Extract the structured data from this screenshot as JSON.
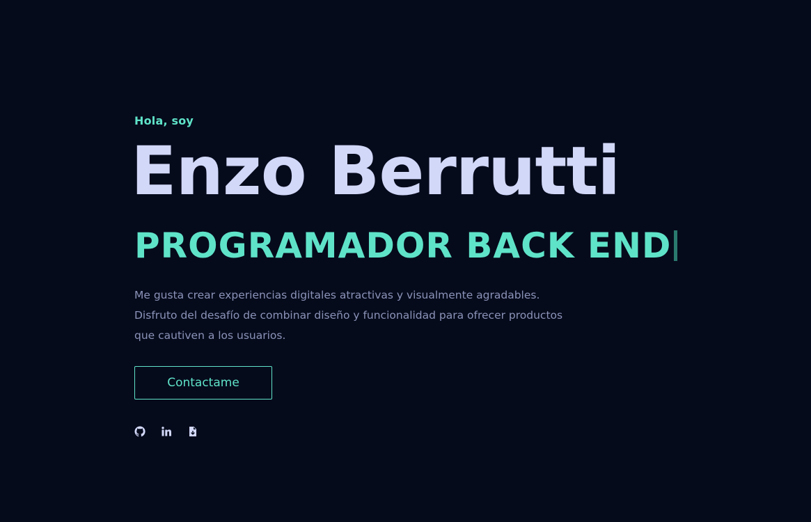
{
  "hero": {
    "greeting": "Hola, soy",
    "name": "Enzo Berrutti",
    "role": "PROGRAMADOR BACK END",
    "description_lines": [
      "Me gusta crear experiencias digitales atractivas y visualmente agradables.",
      "Disfruto del desafío de combinar diseño y funcionalidad para ofrecer productos",
      "que cautiven a los usuarios."
    ],
    "cta_label": "Contactame"
  },
  "socials": [
    {
      "icon": "github-icon"
    },
    {
      "icon": "linkedin-icon"
    },
    {
      "icon": "download-file-icon"
    }
  ],
  "colors": {
    "background": "#060b1c",
    "accent": "#5fe3c8",
    "name": "#d2d8f8",
    "text_muted": "#8b93b8"
  }
}
